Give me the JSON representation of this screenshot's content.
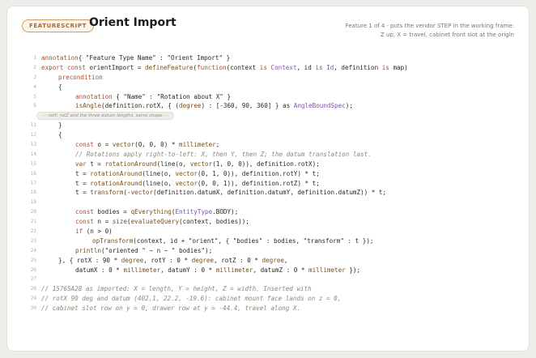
{
  "header": {
    "badge": "FEATURESCRIPT",
    "title": "Orient Import",
    "subtitle_line1": "Feature 1 of 4 · puts the vendor STEP in the working frame:",
    "subtitle_line2": "Z up, X = travel, cabinet front slot at the origin"
  },
  "code_lines": [
    {
      "n": "1",
      "indent": 0,
      "tokens": [
        [
          "kw",
          "annotation"
        ],
        [
          "",
          "{ \"Feature Type Name\" : \"Orient Import\" }"
        ]
      ]
    },
    {
      "n": "2",
      "indent": 0,
      "tokens": [
        [
          "kw",
          "export const"
        ],
        [
          "",
          " orientImport = "
        ],
        [
          "fn",
          "defineFeature"
        ],
        [
          "",
          "("
        ],
        [
          "kw",
          "function"
        ],
        [
          "",
          "(context "
        ],
        [
          "kw",
          "is"
        ],
        [
          "",
          " "
        ],
        [
          "ty",
          "Context"
        ],
        [
          "",
          ", id "
        ],
        [
          "kw",
          "is"
        ],
        [
          "",
          " "
        ],
        [
          "ty",
          "Id"
        ],
        [
          "",
          ", definition "
        ],
        [
          "kw",
          "is"
        ],
        [
          "",
          " map)"
        ]
      ]
    },
    {
      "n": "3",
      "indent": 1,
      "tokens": [
        [
          "kw",
          "precondition"
        ]
      ]
    },
    {
      "n": "4",
      "indent": 1,
      "tokens": [
        [
          "",
          "{"
        ]
      ]
    },
    {
      "n": "5",
      "indent": 2,
      "tokens": [
        [
          "kw",
          "annotation"
        ],
        [
          "",
          " { \"Name\" : \"Rotation about X\" }"
        ]
      ]
    },
    {
      "n": "6",
      "indent": 2,
      "tokens": [
        [
          "fn",
          "isAngle"
        ],
        [
          "",
          "(definition.rotX, { ("
        ],
        [
          "fn",
          "degree"
        ],
        [
          "",
          ") : [-360, 90, 360] } as "
        ],
        [
          "ty",
          "AngleBoundSpec"
        ],
        [
          "",
          ");"
        ]
      ]
    },
    {
      "n": "",
      "fold": "··· rotY, rotZ and the three datum lengths, same shape ···"
    },
    {
      "n": "11",
      "indent": 1,
      "tokens": [
        [
          "",
          "}"
        ]
      ]
    },
    {
      "n": "12",
      "indent": 1,
      "tokens": [
        [
          "",
          "{"
        ]
      ]
    },
    {
      "n": "13",
      "indent": 2,
      "tokens": [
        [
          "kw",
          "const"
        ],
        [
          "",
          " o = "
        ],
        [
          "fn",
          "vector"
        ],
        [
          "",
          "(0, 0, 0) * "
        ],
        [
          "fn",
          "millimeter"
        ],
        [
          "",
          ";"
        ]
      ]
    },
    {
      "n": "14",
      "indent": 2,
      "tokens": [
        [
          "cm",
          "// Rotations apply right-to-left: X, then Y, then Z; the datum translation last."
        ]
      ]
    },
    {
      "n": "15",
      "indent": 2,
      "tokens": [
        [
          "kw",
          "var"
        ],
        [
          "",
          " t = "
        ],
        [
          "fn",
          "rotationAround"
        ],
        [
          "",
          "(line(o, "
        ],
        [
          "fn",
          "vector"
        ],
        [
          "",
          "(1, 0, 0)), definition.rotX);"
        ]
      ]
    },
    {
      "n": "16",
      "indent": 2,
      "tokens": [
        [
          "",
          "t = "
        ],
        [
          "fn",
          "rotationAround"
        ],
        [
          "",
          "(line(o, "
        ],
        [
          "fn",
          "vector"
        ],
        [
          "",
          "(0, 1, 0)), definition.rotY) * t;"
        ]
      ]
    },
    {
      "n": "17",
      "indent": 2,
      "tokens": [
        [
          "",
          "t = "
        ],
        [
          "fn",
          "rotationAround"
        ],
        [
          "",
          "(line(o, "
        ],
        [
          "fn",
          "vector"
        ],
        [
          "",
          "(0, 0, 1)), definition.rotZ) * t;"
        ]
      ]
    },
    {
      "n": "18",
      "indent": 2,
      "tokens": [
        [
          "",
          "t = "
        ],
        [
          "fn",
          "transform"
        ],
        [
          "",
          "(-"
        ],
        [
          "fn",
          "vector"
        ],
        [
          "",
          "(definition.datumX, definition.datumY, definition.datumZ)) * t;"
        ]
      ]
    },
    {
      "n": "19",
      "indent": 0,
      "tokens": [
        [
          "",
          ""
        ]
      ]
    },
    {
      "n": "20",
      "indent": 2,
      "tokens": [
        [
          "kw",
          "const"
        ],
        [
          "",
          " bodies = "
        ],
        [
          "fn",
          "qEverything"
        ],
        [
          "",
          "("
        ],
        [
          "ty",
          "EntityType"
        ],
        [
          "",
          ".BODY);"
        ]
      ]
    },
    {
      "n": "21",
      "indent": 2,
      "tokens": [
        [
          "kw",
          "const"
        ],
        [
          "",
          " n = "
        ],
        [
          "fn",
          "size"
        ],
        [
          "",
          "("
        ],
        [
          "fn",
          "evaluateQuery"
        ],
        [
          "",
          "(context, bodies));"
        ]
      ]
    },
    {
      "n": "22",
      "indent": 2,
      "tokens": [
        [
          "kw",
          "if"
        ],
        [
          "",
          " (n > 0)"
        ]
      ]
    },
    {
      "n": "23",
      "indent": 3,
      "tokens": [
        [
          "fn",
          "opTransform"
        ],
        [
          "",
          "(context, id + \"orient\", { \"bodies\" : bodies, \"transform\" : t });"
        ]
      ]
    },
    {
      "n": "24",
      "indent": 2,
      "tokens": [
        [
          "fn",
          "println"
        ],
        [
          "",
          "(\"oriented \" ~ n ~ \" bodies\");"
        ]
      ]
    },
    {
      "n": "25",
      "indent": 1,
      "tokens": [
        [
          "",
          "}, { rotX : 90 * "
        ],
        [
          "fn",
          "degree"
        ],
        [
          "",
          ", rotY : 0 * "
        ],
        [
          "fn",
          "degree"
        ],
        [
          "",
          ", rotZ : 0 * "
        ],
        [
          "fn",
          "degree"
        ],
        [
          "",
          ","
        ]
      ]
    },
    {
      "n": "26",
      "indent": 2,
      "tokens": [
        [
          "",
          "datumX : 0 * "
        ],
        [
          "fn",
          "millimeter"
        ],
        [
          "",
          ", datumY : 0 * "
        ],
        [
          "fn",
          "millimeter"
        ],
        [
          "",
          ", datumZ : 0 * "
        ],
        [
          "fn",
          "millimeter"
        ],
        [
          "",
          " });"
        ]
      ]
    },
    {
      "n": "27",
      "indent": 0,
      "tokens": [
        [
          "",
          ""
        ]
      ]
    },
    {
      "n": "28",
      "indent": 0,
      "tokens": [
        [
          "cm",
          "// 15765A28 as imported: X = length, Y = height, Z = width. Inserted with"
        ]
      ]
    },
    {
      "n": "29",
      "indent": 0,
      "tokens": [
        [
          "cm",
          "// rotX 90 deg and datum (402.1, 22.2, -19.6): cabinet mount face lands on z = 0,"
        ]
      ]
    },
    {
      "n": "30",
      "indent": 0,
      "tokens": [
        [
          "cm",
          "// cabinet slot row on y = 0, drawer row at y = -44.4, travel along X."
        ]
      ]
    }
  ]
}
